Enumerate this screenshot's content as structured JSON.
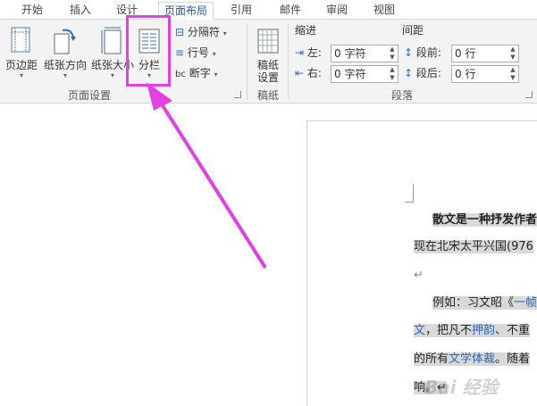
{
  "tabs": [
    {
      "label": "开始"
    },
    {
      "label": "插入"
    },
    {
      "label": "设计"
    },
    {
      "label": "页面布局",
      "active": true
    },
    {
      "label": "引用"
    },
    {
      "label": "邮件"
    },
    {
      "label": "审阅"
    },
    {
      "label": "视图"
    }
  ],
  "ribbon": {
    "page_setup": {
      "label": "页面设置",
      "margins": "页边距",
      "orientation": "纸张方向",
      "size": "纸张大小",
      "columns": "分栏",
      "breaks": "分隔符",
      "line_numbers": "行号",
      "hyphenation": "断字"
    },
    "manuscript": {
      "label": "稿纸",
      "button_line1": "稿纸",
      "button_line2": "设置"
    },
    "paragraph": {
      "label": "段落",
      "indent_title": "缩进",
      "spacing_title": "间距",
      "left_label": "左:",
      "right_label": "右:",
      "before_label": "段前:",
      "after_label": "段后:",
      "left_value": "0 字符",
      "right_value": "0 字符",
      "before_value": "0 行",
      "after_value": "0 行"
    }
  },
  "document": {
    "line1": "散文是一种抒发作者",
    "line2": "现在北宋太平兴国(976",
    "line3": "↵",
    "line4_prefix": "例如：习文昭《",
    "line4_link": "一帧",
    "line5_link1": "文",
    "line5_mid": "，把凡不",
    "line5_link2": "押韵",
    "line5_suffix": "、不重",
    "line6_prefix": "的所有",
    "line6_link": "文学体裁",
    "line6_suffix": "。随着",
    "line7": "响。↵"
  },
  "watermark": "Bai 经验",
  "colors": {
    "accent": "#2b579a",
    "highlight_box": "#e33fe6",
    "arrow": "#e33fe6",
    "text_highlight": "#d9d9d9"
  }
}
